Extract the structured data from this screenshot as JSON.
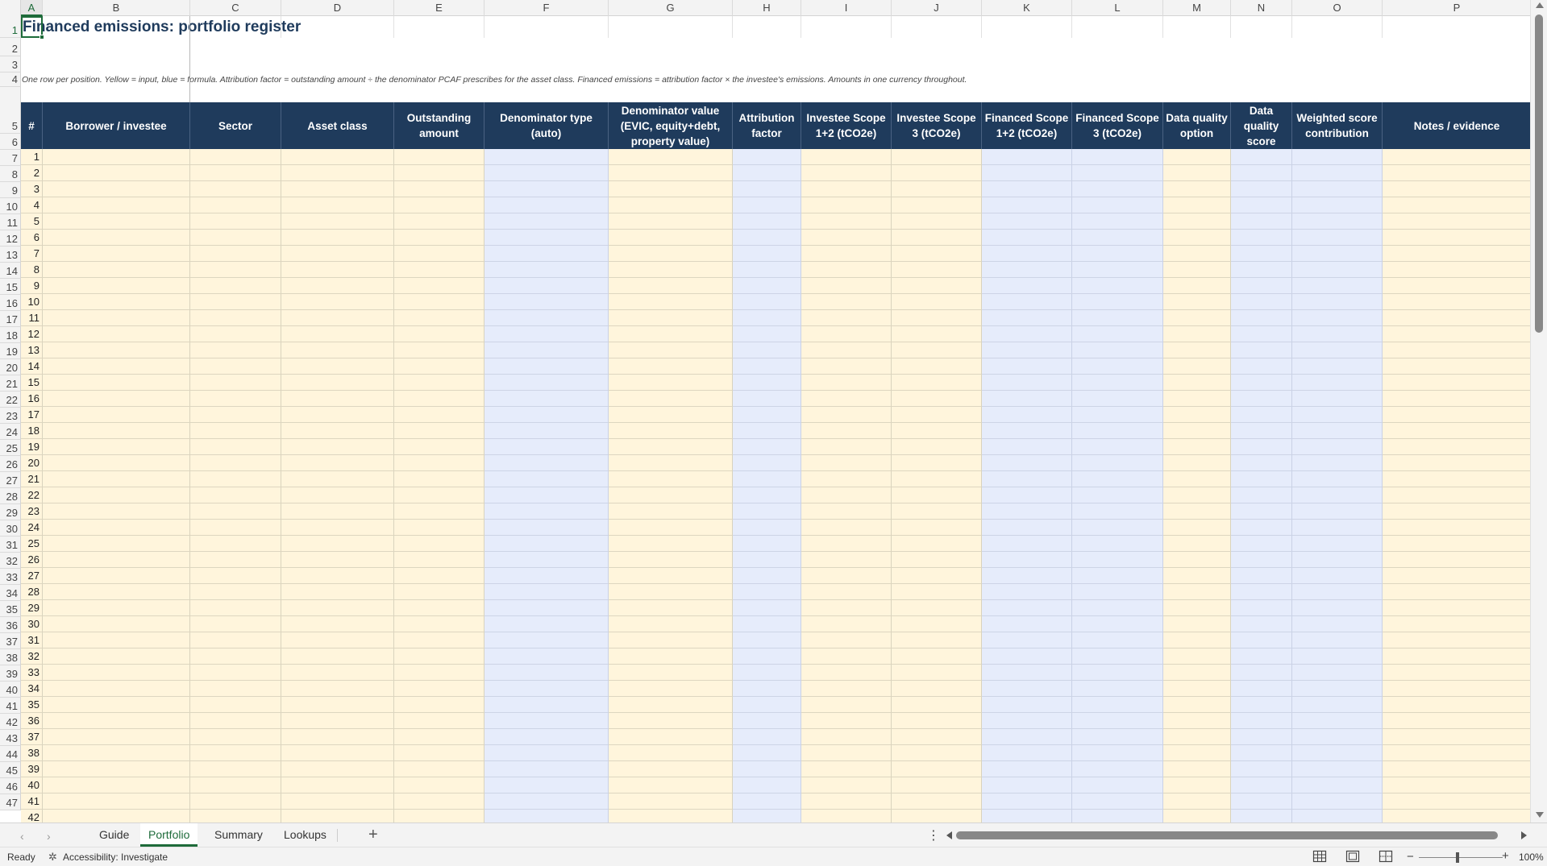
{
  "spreadsheet": {
    "title": "Financed emissions: portfolio register",
    "subtitle": "One row per position. Yellow = input, blue = formula. Attribution factor = outstanding amount ÷ the denominator PCAF prescribes for the asset class. Financed emissions = attribution factor × the investee's emissions. Amounts in one currency throughout.",
    "active_cell": "A1",
    "columns": [
      "A",
      "B",
      "C",
      "D",
      "E",
      "F",
      "G",
      "H",
      "I",
      "J",
      "K",
      "L",
      "M",
      "N",
      "O",
      "P"
    ],
    "row_numbers": [
      "1",
      "2",
      "3",
      "4",
      "5",
      "6",
      "7",
      "8",
      "9",
      "10",
      "11",
      "12",
      "13",
      "14",
      "15",
      "16",
      "17",
      "18",
      "19",
      "20",
      "21",
      "22",
      "23",
      "24",
      "25",
      "26",
      "27",
      "28",
      "29",
      "30",
      "31",
      "32",
      "33",
      "34",
      "35",
      "36",
      "37",
      "38",
      "39",
      "40",
      "41",
      "42",
      "43",
      "44",
      "45",
      "46",
      "47"
    ],
    "headers": [
      "#",
      "Borrower / investee",
      "Sector",
      "Asset class",
      "Outstanding amount",
      "Denominator type (auto)",
      "Denominator value (EVIC, equity+debt, property value)",
      "Attribution factor",
      "Investee Scope 1+2 (tCO2e)",
      "Investee Scope 3 (tCO2e)",
      "Financed Scope 1+2 (tCO2e)",
      "Financed Scope 3 (tCO2e)",
      "Data quality option",
      "Data quality score",
      "Weighted score contribution",
      "Notes / evidence"
    ],
    "column_kinds": [
      "index",
      "input",
      "input",
      "input",
      "input",
      "formula",
      "input",
      "formula",
      "input",
      "input",
      "formula",
      "formula",
      "input",
      "formula",
      "formula",
      "input"
    ],
    "position_numbers": [
      "1",
      "2",
      "3",
      "4",
      "5",
      "6",
      "7",
      "8",
      "9",
      "10",
      "11",
      "12",
      "13",
      "14",
      "15",
      "16",
      "17",
      "18",
      "19",
      "20",
      "21",
      "22",
      "23",
      "24",
      "25",
      "26",
      "27",
      "28",
      "29",
      "30",
      "31",
      "32",
      "33",
      "34",
      "35",
      "36",
      "37",
      "38",
      "39",
      "40",
      "41",
      "42"
    ]
  },
  "colors": {
    "header_band": "#1f3b5c",
    "input_fill": "#fff5dc",
    "formula_fill": "#e6ecfb",
    "accent": "#1e6b3a"
  },
  "tabs": {
    "prev_icon": "chevron-left-icon",
    "next_icon": "chevron-right-icon",
    "items": [
      "Guide",
      "Portfolio",
      "Summary",
      "Lookups"
    ],
    "active": "Portfolio",
    "add_label": "+"
  },
  "status": {
    "ready": "Ready",
    "accessibility": "Accessibility: Investigate",
    "zoom": "100%",
    "zoom_minus": "−",
    "zoom_plus": "+"
  }
}
